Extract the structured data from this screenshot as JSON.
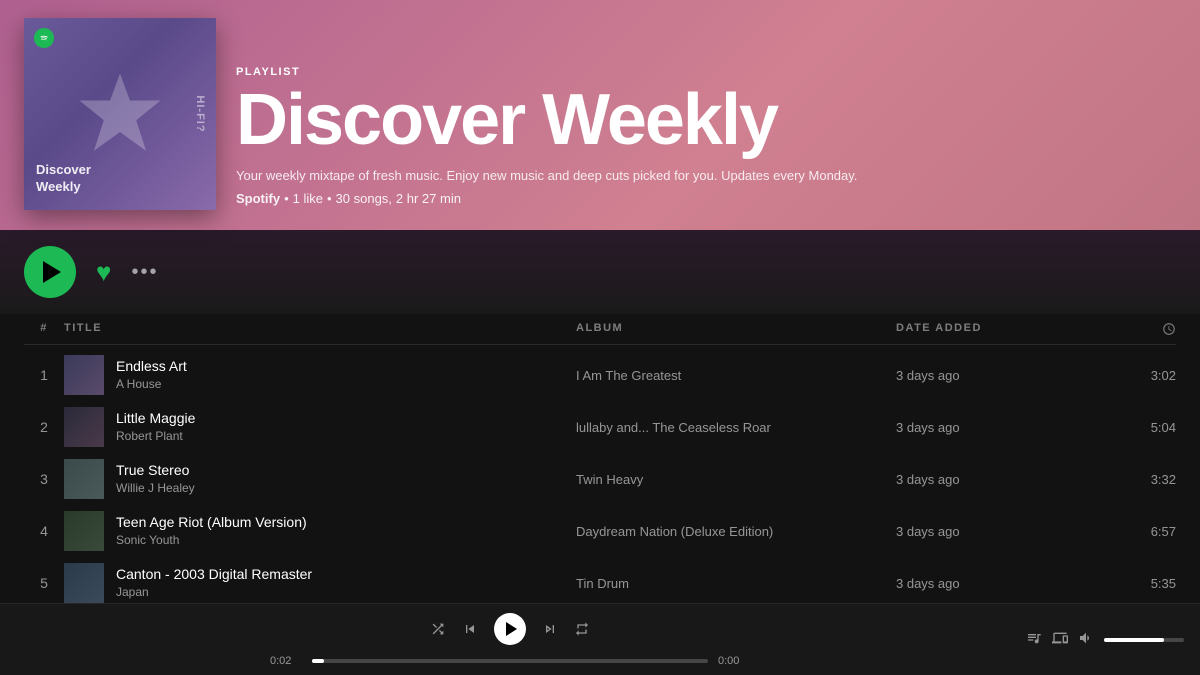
{
  "hero": {
    "type_label": "PLAYLIST",
    "title": "Discover Weekly",
    "description": "Your weekly mixtape of fresh music. Enjoy new music and deep cuts picked for you. Updates every Monday.",
    "spotify_label": "Spotify",
    "meta_likes": "1 like",
    "meta_songs": "30 songs,",
    "meta_duration": "2 hr 27 min",
    "album_art_text1": "Discover",
    "album_art_text2": "Weekly",
    "album_art_hifi": "HI-FI?"
  },
  "controls": {
    "heart_icon": "♥",
    "more_icon": "•••"
  },
  "tracklist": {
    "col_hash": "#",
    "col_title": "TITLE",
    "col_album": "ALBUM",
    "col_date": "DATE ADDED",
    "tracks": [
      {
        "num": "1",
        "title": "Endless Art",
        "artist": "A House",
        "album": "I Am The Greatest",
        "date_added": "3 days ago",
        "duration": "3:02",
        "thumb_class": "track-thumb-1"
      },
      {
        "num": "2",
        "title": "Little Maggie",
        "artist": "Robert Plant",
        "album": "lullaby and... The Ceaseless Roar",
        "date_added": "3 days ago",
        "duration": "5:04",
        "thumb_class": "track-thumb-2"
      },
      {
        "num": "3",
        "title": "True Stereo",
        "artist": "Willie J Healey",
        "album": "Twin Heavy",
        "date_added": "3 days ago",
        "duration": "3:32",
        "thumb_class": "track-thumb-3"
      },
      {
        "num": "4",
        "title": "Teen Age Riot (Album Version)",
        "artist": "Sonic Youth",
        "album": "Daydream Nation (Deluxe Edition)",
        "date_added": "3 days ago",
        "duration": "6:57",
        "thumb_class": "track-thumb-4"
      },
      {
        "num": "5",
        "title": "Canton - 2003 Digital Remaster",
        "artist": "Japan",
        "album": "Tin Drum",
        "date_added": "3 days ago",
        "duration": "5:35",
        "thumb_class": "track-thumb-5"
      }
    ]
  },
  "player": {
    "current_time": "0:02",
    "total_time": "0:00",
    "progress_percent": 3
  }
}
